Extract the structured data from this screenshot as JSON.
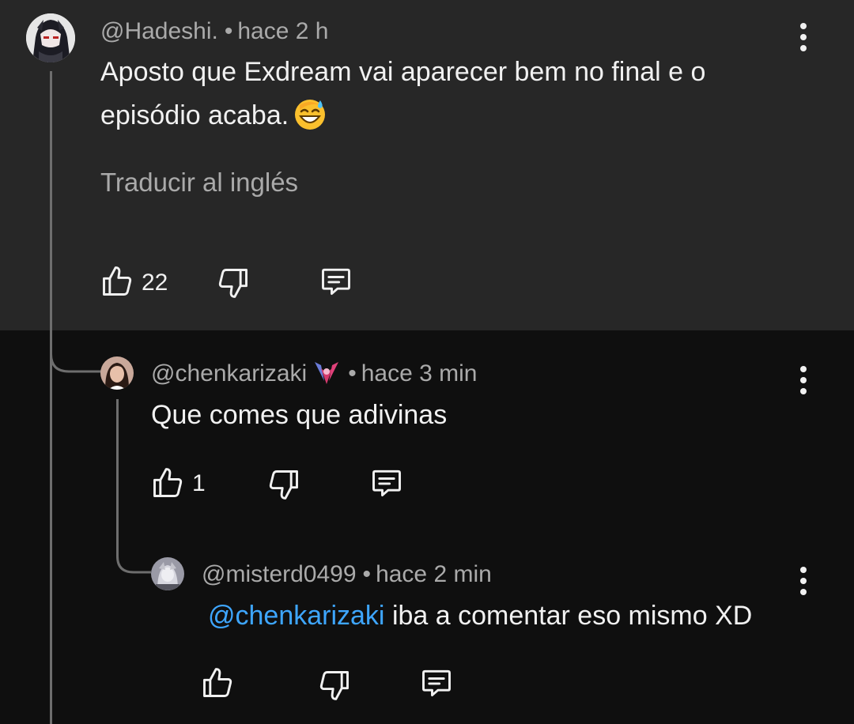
{
  "comment": {
    "author": "@Hadeshi.",
    "time": "hace 2 h",
    "line1": "Aposto que Exdream vai aparecer bem no final e o",
    "line2": "episódio acaba.",
    "translate_label": "Traducir al inglés",
    "like_count": "22"
  },
  "reply1": {
    "author": "@chenkarizaki",
    "time": "hace 3 min",
    "text": "Que comes que adivinas",
    "like_count": "1"
  },
  "reply2": {
    "author": "@misterd0499",
    "time": "hace 2 min",
    "mention": "@chenkarizaki",
    "text": " iba a comentar eso mismo XD"
  },
  "separator": "•",
  "icons": {
    "like": "thumbs-up-icon",
    "dislike": "thumbs-down-icon",
    "reply": "comment-icon",
    "more": "more-vertical-icon"
  },
  "colors": {
    "top_background": "#272727",
    "page_background": "#0f0f0f",
    "text_primary": "#f1f1f1",
    "text_secondary": "#aaaaaa",
    "mention": "#3ea6ff"
  }
}
